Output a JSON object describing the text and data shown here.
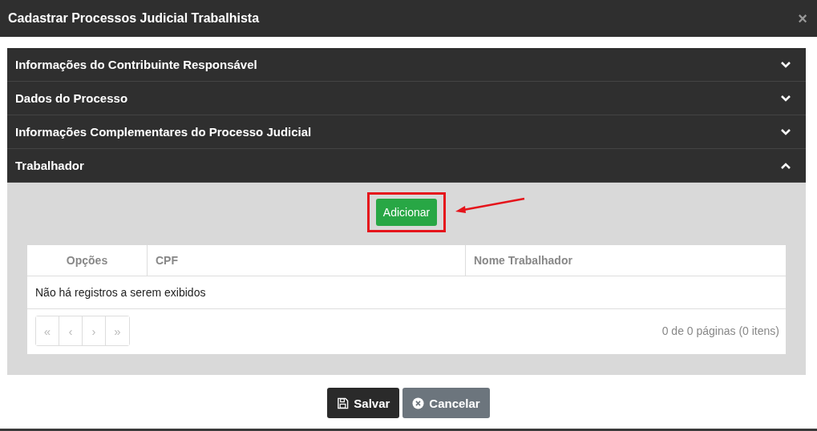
{
  "window": {
    "title": "Cadastrar Processos Judicial Trabalhista",
    "close": "×"
  },
  "sections": [
    {
      "title": "Informações do Contribuinte Responsável",
      "expanded": false
    },
    {
      "title": "Dados do Processo",
      "expanded": false
    },
    {
      "title": "Informações Complementares do Processo Judicial",
      "expanded": false
    },
    {
      "title": "Trabalhador",
      "expanded": true
    }
  ],
  "add_button": {
    "label": "Adicionar",
    "highlighted": true
  },
  "table": {
    "columns": [
      "Opções",
      "CPF",
      "Nome Trabalhador"
    ],
    "empty_message": "Não há registros a serem exibidos"
  },
  "pager": {
    "buttons": [
      "«",
      "‹",
      "›",
      "»"
    ],
    "summary": "0 de 0 páginas (0 itens)"
  },
  "footer": {
    "save": "Salvar",
    "cancel": "Cancelar"
  }
}
